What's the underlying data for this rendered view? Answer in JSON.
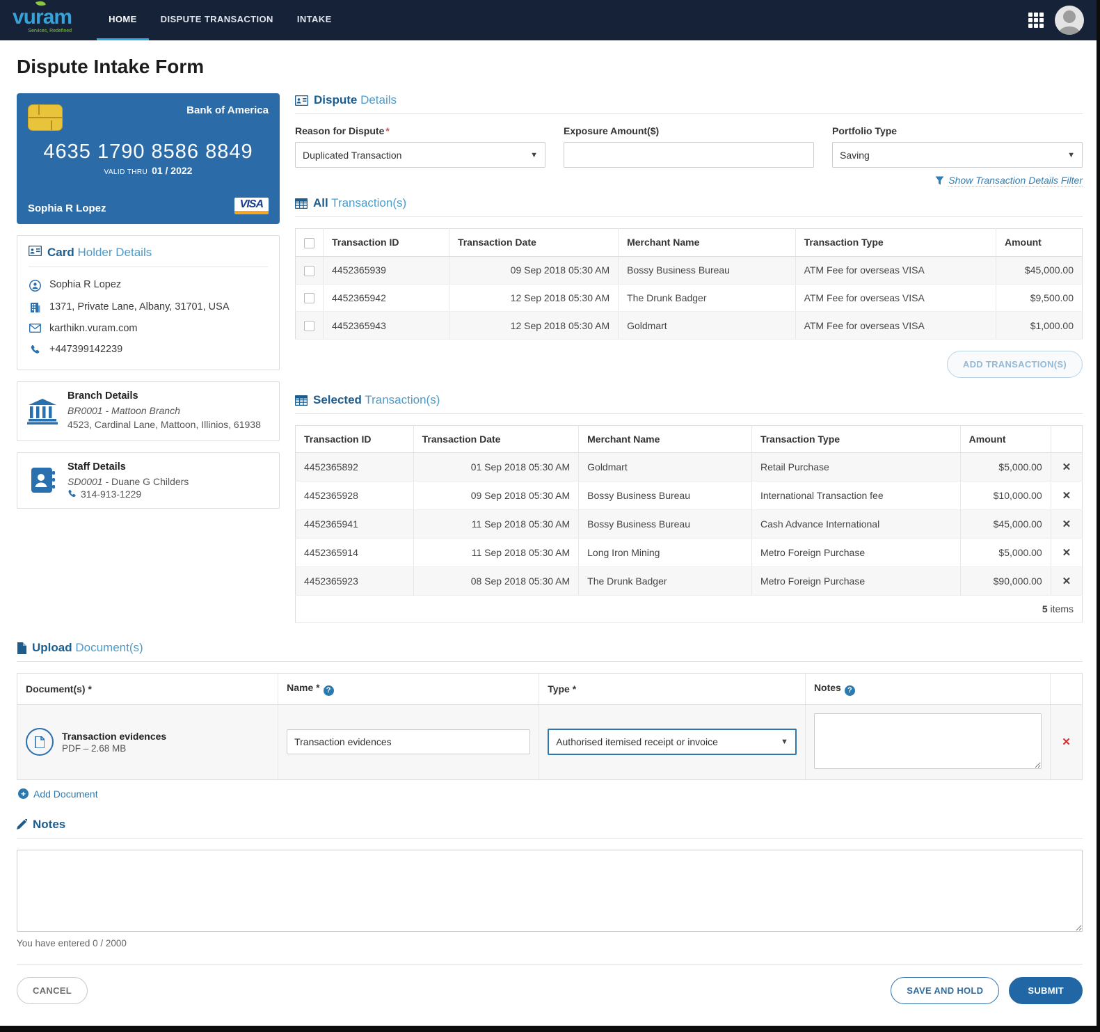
{
  "nav": {
    "brand": "vuram",
    "brand_left": "vu",
    "brand_mid": "r",
    "brand_right": "am",
    "tagline": "Services, Redefined",
    "items": [
      {
        "label": "HOME",
        "active": true
      },
      {
        "label": "DISPUTE TRANSACTION",
        "active": false
      },
      {
        "label": "INTAKE",
        "active": false
      }
    ]
  },
  "page": {
    "title": "Dispute Intake Form"
  },
  "card": {
    "bank": "Bank of America",
    "number": "4635 1790 8586 8849",
    "valid_label": "VALID THRU",
    "valid_value": "01 / 2022",
    "holder": "Sophia R Lopez",
    "network": "VISA",
    "bg_color": "#2b6ca8"
  },
  "card_holder": {
    "title_strong": "Card",
    "title_rest": "Holder Details",
    "name": "Sophia R Lopez",
    "address": "1371, Private Lane, Albany, 31701, USA",
    "email": "karthikn.vuram.com",
    "phone": "+447399142239"
  },
  "branch": {
    "title": "Branch Details",
    "code_name": "BR0001 - Mattoon Branch",
    "address": "4523, Cardinal Lane, Mattoon, Illinios, 61938"
  },
  "staff": {
    "title": "Staff Details",
    "code": "SD0001",
    "name_rest": " - Duane  G Childers",
    "phone": "314-913-1229"
  },
  "dispute": {
    "title_strong": "Dispute",
    "title_rest": "Details",
    "reason_label": "Reason for Dispute",
    "reason_value": "Duplicated Transaction",
    "exposure_label": "Exposure Amount($)",
    "exposure_value": "",
    "portfolio_label": "Portfolio Type",
    "portfolio_value": "Saving",
    "filter_link": "Show Transaction Details Filter"
  },
  "all_transactions": {
    "title_strong": "All",
    "title_rest": "Transaction(s)",
    "columns": [
      "Transaction ID",
      "Transaction Date",
      "Merchant Name",
      "Transaction Type",
      "Amount"
    ],
    "rows": [
      {
        "id": "4452365939",
        "date": "09 Sep 2018 05:30 AM",
        "merchant": "Bossy Business Bureau",
        "type": "ATM Fee for overseas VISA",
        "amount": "$45,000.00"
      },
      {
        "id": "4452365942",
        "date": "12 Sep 2018 05:30 AM",
        "merchant": "The Drunk Badger",
        "type": "ATM Fee for overseas VISA",
        "amount": "$9,500.00"
      },
      {
        "id": "4452365943",
        "date": "12 Sep 2018 05:30 AM",
        "merchant": "Goldmart",
        "type": "ATM Fee for overseas VISA",
        "amount": "$1,000.00"
      }
    ],
    "add_button": "ADD TRANSACTION(S)"
  },
  "selected_transactions": {
    "title_strong": "Selected",
    "title_rest": "Transaction(s)",
    "columns": [
      "Transaction ID",
      "Transaction Date",
      "Merchant Name",
      "Transaction Type",
      "Amount"
    ],
    "rows": [
      {
        "id": "4452365892",
        "date": "01 Sep 2018 05:30 AM",
        "merchant": "Goldmart",
        "type": "Retail Purchase",
        "amount": "$5,000.00"
      },
      {
        "id": "4452365928",
        "date": "09 Sep 2018 05:30 AM",
        "merchant": "Bossy Business Bureau",
        "type": "International Transaction fee",
        "amount": "$10,000.00"
      },
      {
        "id": "4452365941",
        "date": "11 Sep 2018 05:30 AM",
        "merchant": "Bossy Business Bureau",
        "type": "Cash Advance International",
        "amount": "$45,000.00"
      },
      {
        "id": "4452365914",
        "date": "11 Sep 2018 05:30 AM",
        "merchant": "Long Iron Mining",
        "type": "Metro Foreign Purchase",
        "amount": "$5,000.00"
      },
      {
        "id": "4452365923",
        "date": "08 Sep 2018 05:30 AM",
        "merchant": "The Drunk Badger",
        "type": "Metro Foreign Purchase",
        "amount": "$90,000.00"
      }
    ],
    "count": "5",
    "count_label": " items",
    "delete_glyph": "✕"
  },
  "upload": {
    "title_strong": "Upload",
    "title_rest": "Document(s)",
    "col_document": "Document(s) *",
    "col_name": "Name *",
    "col_type": "Type *",
    "col_notes": "Notes",
    "help_glyph": "?",
    "row": {
      "file_name": "Transaction evidences",
      "file_meta": "PDF – 2.68 MB",
      "name_value": "Transaction evidences",
      "type_value": "Authorised itemised receipt or invoice",
      "notes_value": ""
    },
    "add_link": "Add Document",
    "delete_glyph": "✕"
  },
  "notes": {
    "title": "Notes",
    "value": "",
    "counter": "You have entered 0 / 2000"
  },
  "footer": {
    "cancel": "CANCEL",
    "save_hold": "SAVE AND HOLD",
    "submit": "SUBMIT"
  },
  "colors": {
    "navbar": "#152238",
    "accent_blue": "#2166a5",
    "header_strong": "#1c5d90",
    "header_light": "#4d9bc9",
    "link_blue": "#2d7fb8",
    "danger_red": "#cc2f2f",
    "card_blue": "#2b6ca8",
    "active_tab_underline": "#29a9e0"
  }
}
